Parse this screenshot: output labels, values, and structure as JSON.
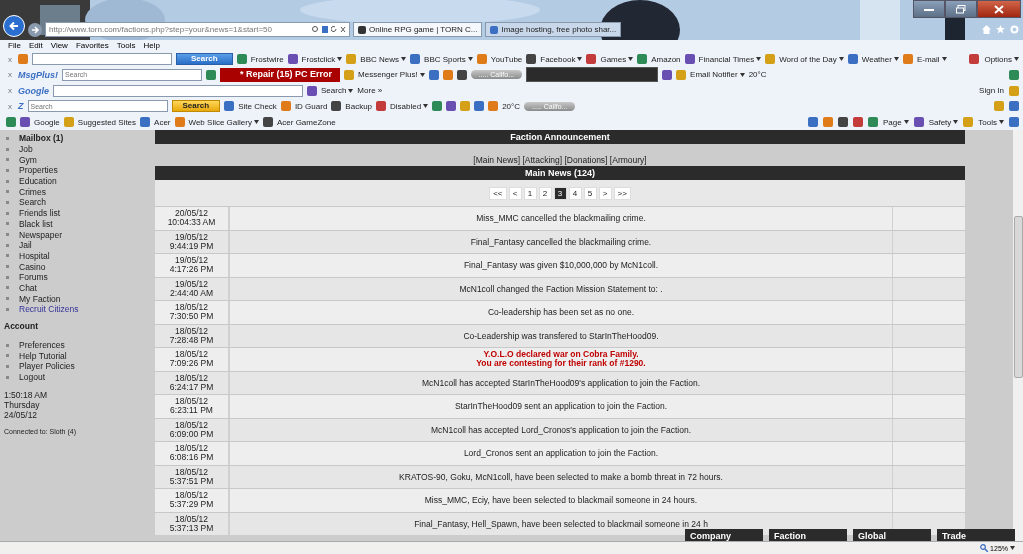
{
  "browser": {
    "address": "http://www.torn.com/factions.php?step=your&news=1&start=50",
    "tabs": [
      {
        "label": "Online RPG game | TORN C...",
        "selected": true
      },
      {
        "label": "Image hosting, free photo shar...",
        "selected": false
      }
    ],
    "menu": [
      "File",
      "Edit",
      "View",
      "Favorites",
      "Tools",
      "Help"
    ]
  },
  "toolbars": [
    {
      "left": [
        {
          "kind": "close",
          "text": "x"
        },
        {
          "kind": "icon"
        },
        {
          "kind": "field"
        },
        {
          "kind": "blue-button",
          "text": "Search"
        },
        {
          "kind": "link",
          "text": "Frostwire",
          "dropdown": false
        },
        {
          "kind": "link",
          "text": "Frostclick",
          "dropdown": true
        },
        {
          "kind": "link",
          "text": "BBC News",
          "dropdown": true
        },
        {
          "kind": "link",
          "text": "BBC Sports",
          "dropdown": true
        },
        {
          "kind": "link",
          "text": "YouTube",
          "dropdown": false
        },
        {
          "kind": "link",
          "text": "Facebook",
          "dropdown": true
        },
        {
          "kind": "link",
          "text": "Games",
          "dropdown": true
        },
        {
          "kind": "link",
          "text": "Amazon",
          "dropdown": false
        },
        {
          "kind": "link",
          "text": "Financial Times",
          "dropdown": true
        },
        {
          "kind": "link",
          "text": "Word of the Day",
          "dropdown": true
        },
        {
          "kind": "link",
          "text": "Weather",
          "dropdown": true
        },
        {
          "kind": "link",
          "text": "E-mail",
          "dropdown": true
        }
      ],
      "right": [
        {
          "kind": "link",
          "text": "Options",
          "dropdown": true
        }
      ]
    },
    {
      "left": [
        {
          "kind": "close",
          "text": "x"
        },
        {
          "kind": "logo",
          "text": "MsgPlus!"
        },
        {
          "kind": "field",
          "placeholder": "Search"
        },
        {
          "kind": "icon"
        },
        {
          "kind": "banner",
          "text": "* Repair (15) PC Error"
        },
        {
          "kind": "link",
          "text": "Messenger Plus!",
          "dropdown": true
        },
        {
          "kind": "icon"
        },
        {
          "kind": "icon"
        },
        {
          "kind": "icon"
        },
        {
          "kind": "player",
          "text": "..... Califo..."
        },
        {
          "kind": "notice"
        },
        {
          "kind": "icon"
        },
        {
          "kind": "link",
          "text": "Email Notifier",
          "dropdown": true
        },
        {
          "kind": "text",
          "text": "20°C"
        }
      ],
      "right": [
        {
          "kind": "icon"
        }
      ]
    },
    {
      "left": [
        {
          "kind": "close",
          "text": "x"
        },
        {
          "kind": "logo",
          "text": "Google"
        },
        {
          "kind": "wide-field"
        },
        {
          "kind": "link",
          "text": "Search",
          "dropdown": true
        },
        {
          "kind": "text",
          "text": "More »"
        }
      ],
      "right": [
        {
          "kind": "text",
          "text": "Sign In"
        },
        {
          "kind": "icon"
        }
      ]
    },
    {
      "left": [
        {
          "kind": "close",
          "text": "x"
        },
        {
          "kind": "logo",
          "text": "Z"
        },
        {
          "kind": "field",
          "placeholder": "Search"
        },
        {
          "kind": "gold-button",
          "text": "Search"
        },
        {
          "kind": "link",
          "text": "Site Check",
          "dropdown": false
        },
        {
          "kind": "link",
          "text": "ID Guard",
          "dropdown": false
        },
        {
          "kind": "link",
          "text": "Backup",
          "dropdown": false
        },
        {
          "kind": "link",
          "text": "Disabled",
          "dropdown": true
        },
        {
          "kind": "icon"
        },
        {
          "kind": "icon"
        },
        {
          "kind": "icon"
        },
        {
          "kind": "icon"
        },
        {
          "kind": "icon"
        },
        {
          "kind": "text",
          "text": "20°C"
        },
        {
          "kind": "player",
          "text": "..... Califo..."
        }
      ],
      "right": [
        {
          "kind": "icon"
        },
        {
          "kind": "icon"
        }
      ]
    },
    {
      "left": [
        {
          "kind": "icon"
        },
        {
          "kind": "link",
          "text": "Google",
          "dropdown": false
        },
        {
          "kind": "link",
          "text": "Suggested Sites",
          "dropdown": false
        },
        {
          "kind": "link",
          "text": "Acer",
          "dropdown": false
        },
        {
          "kind": "link",
          "text": "Web Slice Gallery",
          "dropdown": true
        },
        {
          "kind": "link",
          "text": "Acer GameZone",
          "dropdown": false
        }
      ],
      "right": [
        {
          "kind": "icon"
        },
        {
          "kind": "icon"
        },
        {
          "kind": "icon"
        },
        {
          "kind": "icon"
        },
        {
          "kind": "link",
          "text": "Page",
          "dropdown": true
        },
        {
          "kind": "link",
          "text": "Safety",
          "dropdown": true
        },
        {
          "kind": "link",
          "text": "Tools",
          "dropdown": true
        },
        {
          "kind": "icon"
        }
      ]
    }
  ],
  "sidebar": {
    "items": [
      {
        "label": "Mailbox (1)",
        "kind": "bold"
      },
      {
        "label": "Job",
        "kind": "plain"
      },
      {
        "label": "Gym",
        "kind": "plain"
      },
      {
        "label": "Properties",
        "kind": "plain"
      },
      {
        "label": "Education",
        "kind": "plain"
      },
      {
        "label": "Crimes",
        "kind": "plain"
      },
      {
        "label": "Search",
        "kind": "plain"
      },
      {
        "label": "Friends list",
        "kind": "plain"
      },
      {
        "label": "Black list",
        "kind": "plain"
      },
      {
        "label": "Newspaper",
        "kind": "plain"
      },
      {
        "label": "Jail",
        "kind": "plain"
      },
      {
        "label": "Hospital",
        "kind": "plain"
      },
      {
        "label": "Casino",
        "kind": "plain"
      },
      {
        "label": "Forums",
        "kind": "plain"
      },
      {
        "label": "Chat",
        "kind": "plain"
      },
      {
        "label": "My Faction",
        "kind": "plain"
      },
      {
        "label": "Recruit Citizens",
        "kind": "link"
      }
    ],
    "account_title": "Account",
    "account_items": [
      "Preferences",
      "Help Tutorial",
      "Player Policies",
      "Logout"
    ],
    "clock": [
      "1:50:18 AM",
      "Thursday",
      "24/05/12"
    ],
    "connected": "Connected to: Sloth (4)"
  },
  "main": {
    "announcement_title": "Faction Announcement",
    "news_links": [
      "[Main News]",
      "[Attacking]",
      "[Donations]",
      "[Armoury]"
    ],
    "news_title": "Main News (124)",
    "pages": [
      {
        "label": "<<",
        "selected": false
      },
      {
        "label": "<",
        "selected": false
      },
      {
        "label": "1",
        "selected": false
      },
      {
        "label": "2",
        "selected": false
      },
      {
        "label": "3",
        "selected": true
      },
      {
        "label": "4",
        "selected": false
      },
      {
        "label": "5",
        "selected": false
      },
      {
        "label": ">",
        "selected": false
      },
      {
        "label": ">>",
        "selected": false
      }
    ],
    "rows": [
      {
        "date": "20/05/12",
        "time": "10:04:33 AM",
        "kind": "normal",
        "lines": [
          "Miss_MMC cancelled the blackmailing crime."
        ]
      },
      {
        "date": "19/05/12",
        "time": "9:44:19 PM",
        "kind": "normal",
        "lines": [
          "Final_Fantasy cancelled the blackmailing crime."
        ]
      },
      {
        "date": "19/05/12",
        "time": "4:17:26 PM",
        "kind": "normal",
        "lines": [
          "Final_Fantasy was given $10,000,000 by McN1coll."
        ]
      },
      {
        "date": "19/05/12",
        "time": "2:44:40 AM",
        "kind": "normal",
        "lines": [
          "McN1coll changed the Faction Mission Statement to: ."
        ]
      },
      {
        "date": "18/05/12",
        "time": "7:30:50 PM",
        "kind": "normal",
        "lines": [
          "Co-leadership has been set as no one."
        ]
      },
      {
        "date": "18/05/12",
        "time": "7:28:48 PM",
        "kind": "normal",
        "lines": [
          "Co-Leadership was transfered to StarInTheHood09."
        ]
      },
      {
        "date": "18/05/12",
        "time": "7:09:26 PM",
        "kind": "war",
        "lines": [
          "Y.O.L.O declared war on Cobra Family.",
          "You are contesting for their rank of #1290."
        ]
      },
      {
        "date": "18/05/12",
        "time": "6:24:17 PM",
        "kind": "normal",
        "lines": [
          "McN1coll has accepted StarInTheHood09's application to join the Faction."
        ]
      },
      {
        "date": "18/05/12",
        "time": "6:23:11 PM",
        "kind": "normal",
        "lines": [
          "StarInTheHood09 sent an application to join the Faction."
        ]
      },
      {
        "date": "18/05/12",
        "time": "6:09:00 PM",
        "kind": "normal",
        "lines": [
          "McN1coll has accepted Lord_Cronos's application to join the Faction."
        ]
      },
      {
        "date": "18/05/12",
        "time": "6:08:16 PM",
        "kind": "normal",
        "lines": [
          "Lord_Cronos sent an application to join the Faction."
        ]
      },
      {
        "date": "18/05/12",
        "time": "5:37:51 PM",
        "kind": "normal",
        "lines": [
          "KRATOS-90, Goku, McN1coll, have been selected to make a bomb threat in 72 hours."
        ]
      },
      {
        "date": "18/05/12",
        "time": "5:37:29 PM",
        "kind": "normal",
        "lines": [
          "Miss_MMC, Eciy, have been selected to blackmail someone in 24 hours."
        ]
      },
      {
        "date": "18/05/12",
        "time": "5:37:13 PM",
        "kind": "normal",
        "lines": [
          "Final_Fantasy, Hell_Spawn, have been selected to blackmail someone in 24 h"
        ]
      }
    ]
  },
  "chat_tabs": [
    "Company",
    "Faction",
    "Global",
    "Trade"
  ],
  "status_bar": {
    "zoom": "125%"
  }
}
